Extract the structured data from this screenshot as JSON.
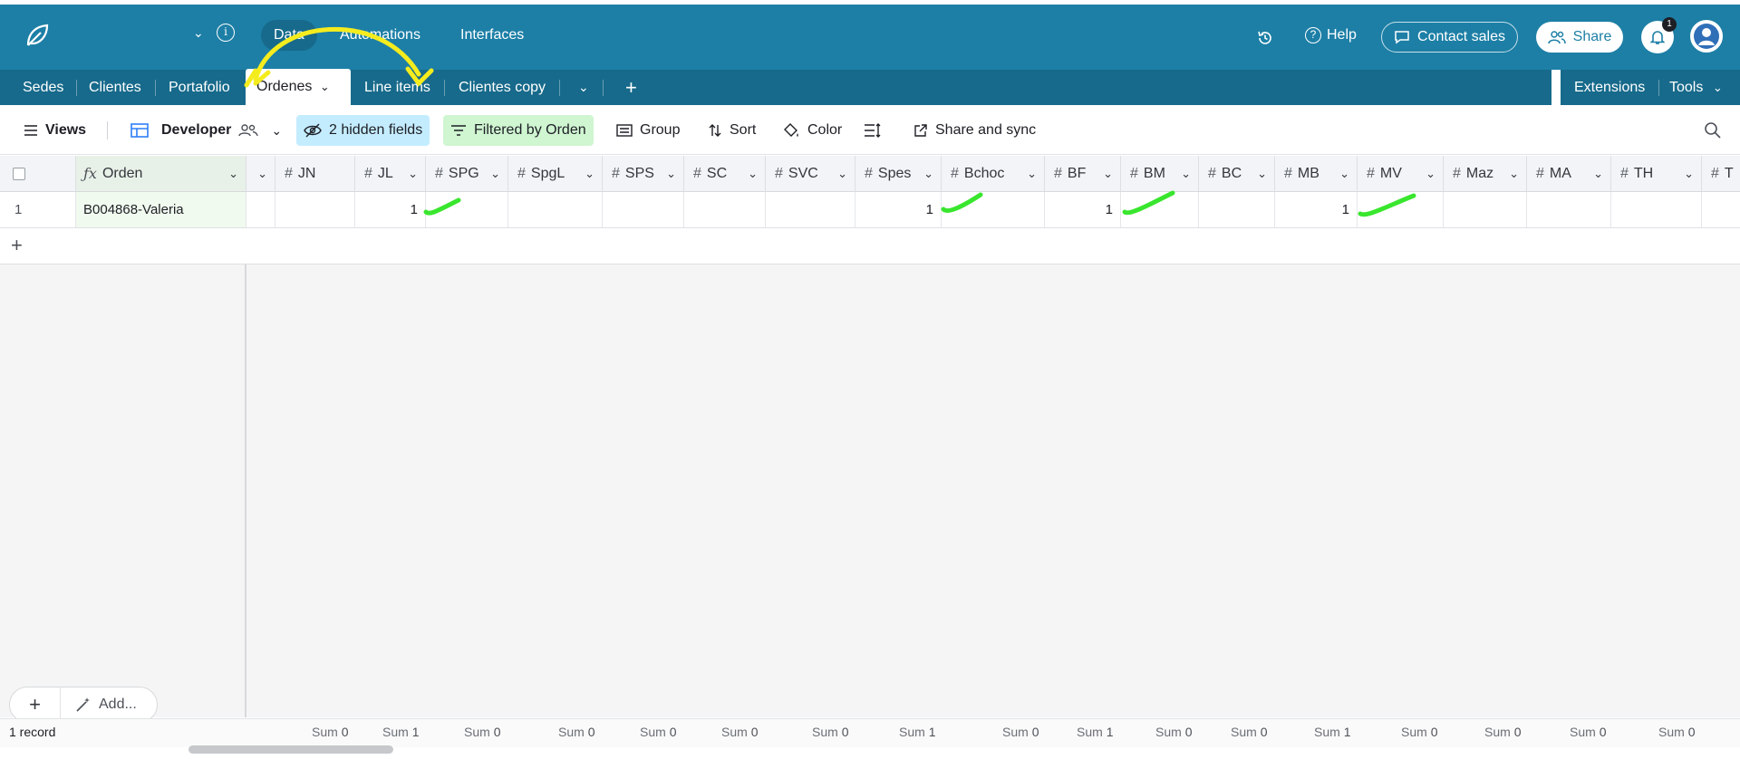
{
  "topbar": {
    "tabs": [
      {
        "label": "Data",
        "active": true
      },
      {
        "label": "Automations",
        "active": false
      },
      {
        "label": "Interfaces",
        "active": false
      }
    ],
    "help_label": "Help",
    "contact_sales_label": "Contact sales",
    "share_label": "Share",
    "notification_count": "1",
    "brand_color": "#1d7fa6"
  },
  "table_tabs": {
    "tabs": [
      "Sedes",
      "Clientes",
      "Portafolio",
      "Ordenes",
      "Line items",
      "Clientes copy"
    ],
    "active": "Ordenes",
    "extensions_label": "Extensions",
    "tools_label": "Tools"
  },
  "viewbar": {
    "views_label": "Views",
    "view_name": "Developer",
    "hidden_fields_label": "2 hidden fields",
    "filter_label": "Filtered by Orden",
    "group_label": "Group",
    "sort_label": "Sort",
    "color_label": "Color",
    "share_sync_label": "Share and sync"
  },
  "grid": {
    "primary_field": "Orden",
    "columns": [
      "JN",
      "JL",
      "SPG",
      "SpgL",
      "SPS",
      "SC",
      "SVC",
      "Spes",
      "Bchoc",
      "BF",
      "BM",
      "BC",
      "MB",
      "MV",
      "Maz",
      "MA",
      "TH",
      "T"
    ],
    "rows": [
      {
        "index": "1",
        "orden": "B004868-Valeria",
        "values": {
          "JL": "1",
          "Spes": "1",
          "BF": "1",
          "MB": "1"
        }
      }
    ],
    "add_label": "Add...",
    "record_count": "1 record",
    "sums": [
      {
        "label": "Sum",
        "value": "0"
      },
      {
        "label": "Sum",
        "value": "1"
      },
      {
        "label": "Sum",
        "value": "0"
      },
      {
        "label": "Sum",
        "value": "0"
      },
      {
        "label": "Sum",
        "value": "0"
      },
      {
        "label": "Sum",
        "value": "0"
      },
      {
        "label": "Sum",
        "value": "0"
      },
      {
        "label": "Sum",
        "value": "1"
      },
      {
        "label": "Sum",
        "value": "0"
      },
      {
        "label": "Sum",
        "value": "1"
      },
      {
        "label": "Sum",
        "value": "0"
      },
      {
        "label": "Sum",
        "value": "0"
      },
      {
        "label": "Sum",
        "value": "1"
      },
      {
        "label": "Sum",
        "value": "0"
      },
      {
        "label": "Sum",
        "value": "0"
      },
      {
        "label": "Sum",
        "value": "0"
      },
      {
        "label": "Sum",
        "value": "0"
      }
    ]
  }
}
